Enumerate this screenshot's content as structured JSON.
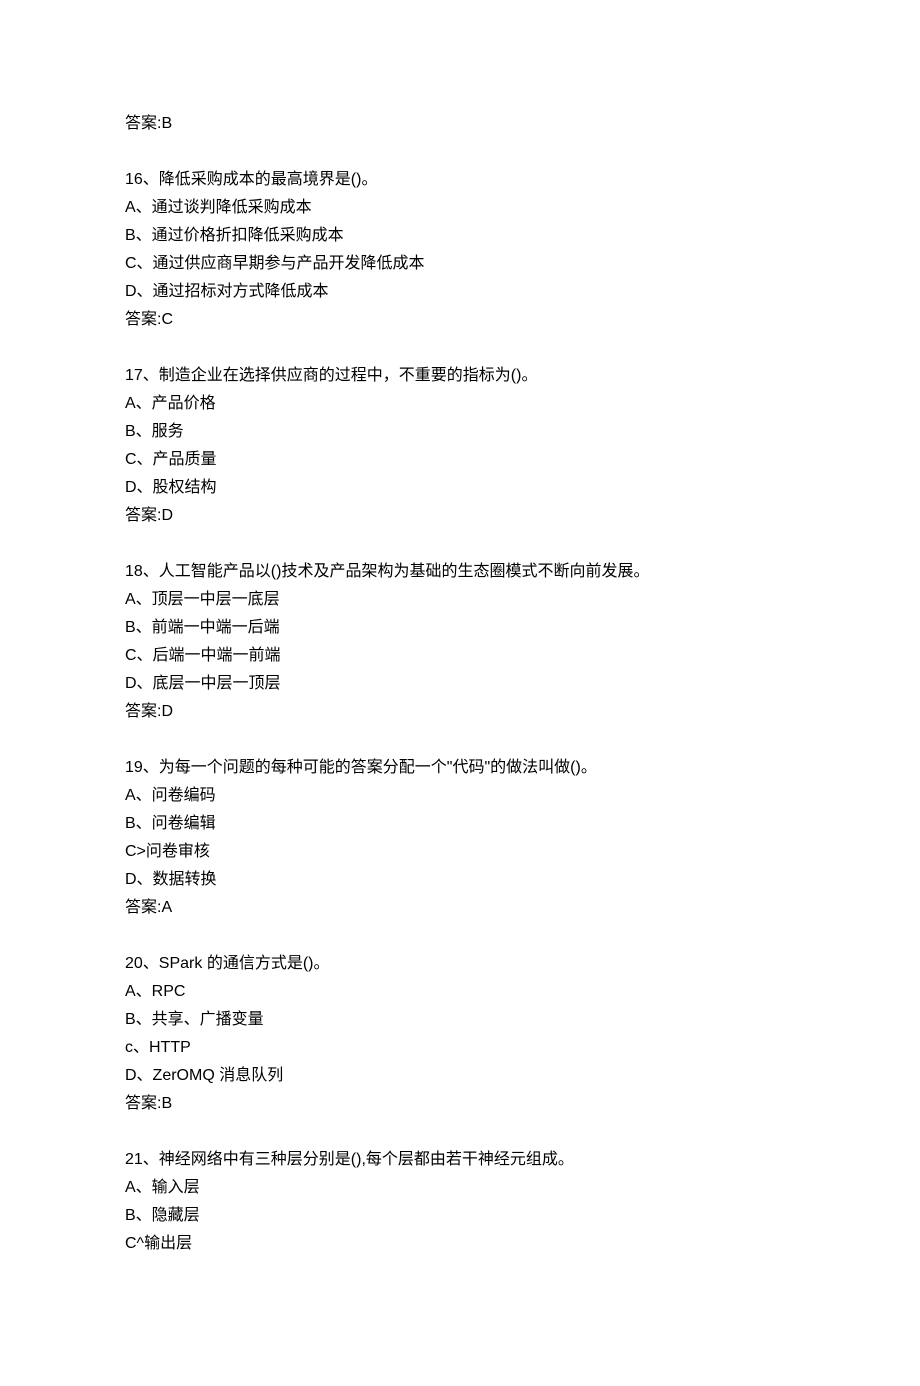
{
  "orphan_answer": "答案:B",
  "questions": [
    {
      "q": "16、降低采购成本的最高境界是()。",
      "opts": [
        "A、通过谈判降低采购成本",
        "B、通过价格折扣降低采购成本",
        "C、通过供应商早期参与产品开发降低成本",
        "D、通过招标对方式降低成本"
      ],
      "ans": "答案:C"
    },
    {
      "q": "17、制造企业在选择供应商的过程中，不重要的指标为()。",
      "opts": [
        "A、产品价格",
        "B、服务",
        "C、产品质量",
        "D、股权结构"
      ],
      "ans": "答案:D"
    },
    {
      "q": "18、人工智能产品以()技术及产品架构为基础的生态圈模式不断向前发展。",
      "opts": [
        "A、顶层一中层一底层",
        "B、前端一中端一后端",
        "C、后端一中端一前端",
        "D、底层一中层一顶层"
      ],
      "ans": "答案:D"
    },
    {
      "q": "19、为每一个问题的每种可能的答案分配一个\"代码\"的做法叫做()。",
      "opts": [
        "A、问卷编码",
        "B、问卷编辑",
        "C>问卷审核",
        "D、数据转换"
      ],
      "ans": "答案:A"
    },
    {
      "q": "20、SPark 的通信方式是()。",
      "opts": [
        "A、RPC",
        "B、共享、广播变量",
        "c、HTTP",
        "D、ZerOMQ 消息队列"
      ],
      "ans": "答案:B"
    },
    {
      "q": "21、神经网络中有三种层分别是(),每个层都由若干神经元组成。",
      "opts": [
        "A、输入层",
        "B、隐藏层",
        "C^输出层"
      ],
      "ans": null
    }
  ]
}
